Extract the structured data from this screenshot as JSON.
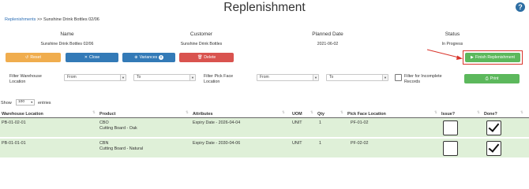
{
  "page": {
    "title": "Replenishment",
    "help_icon": "question-circle-icon",
    "breadcrumb": {
      "root": "Replenishments",
      "separator": ">>",
      "current": "Sunshine Drink Bottles 02/06"
    }
  },
  "summary": {
    "name_label": "Name",
    "name_value": "Sunshine Drink Bottles 02/06",
    "customer_label": "Customer",
    "customer_value": "Sunshine Drink Bottles",
    "planned_label": "Planned Date",
    "planned_value": "2021-06-02",
    "status_label": "Status",
    "status_value": "In Progress"
  },
  "actions": {
    "reset": "Reset",
    "close": "Close",
    "variances": "Variances",
    "variances_count": "0",
    "delete": "Delete",
    "finish": "Finish Replenishment"
  },
  "filters": {
    "warehouse_label_1": "Filter Warehouse",
    "warehouse_label_2": "Location",
    "wh_from": "From",
    "wh_to": "To",
    "pickface_label_1": "Filter Pick Face",
    "pickface_label_2": "Location",
    "pf_from": "From",
    "pf_to": "To",
    "incomplete_label_1": "Filter for Incomplete",
    "incomplete_label_2": "Records",
    "print": "Print"
  },
  "entries": {
    "show": "Show",
    "value": "100",
    "suffix": "entries"
  },
  "table": {
    "columns": [
      "Warehouse Location",
      "Product",
      "Attributes",
      "UOM",
      "Qty",
      "Pick Face Location",
      "Issue?",
      "Done?"
    ],
    "rows": [
      {
        "warehouse": "PB-01-02-01",
        "product_code": "CBO",
        "product_name": "Cutting Board - Oak",
        "attributes": "Expiry Date - 2026-04-04",
        "uom": "UNIT",
        "qty": "1",
        "pick_face": "PF-01-02",
        "issue": false,
        "done": true
      },
      {
        "warehouse": "PB-01-01-01",
        "product_code": "CBN",
        "product_name": "Cutting Board - Natural",
        "attributes": "Expiry Date - 2030-04-06",
        "uom": "UNIT",
        "qty": "1",
        "pick_face": "PF-02-02",
        "issue": false,
        "done": true
      }
    ]
  },
  "colors": {
    "row_bg": "#dff0d8",
    "primary": "#337ab7",
    "warning": "#f0ad4e",
    "danger": "#d9534f",
    "success": "#5cb85c",
    "annotation": "#d9342b"
  }
}
